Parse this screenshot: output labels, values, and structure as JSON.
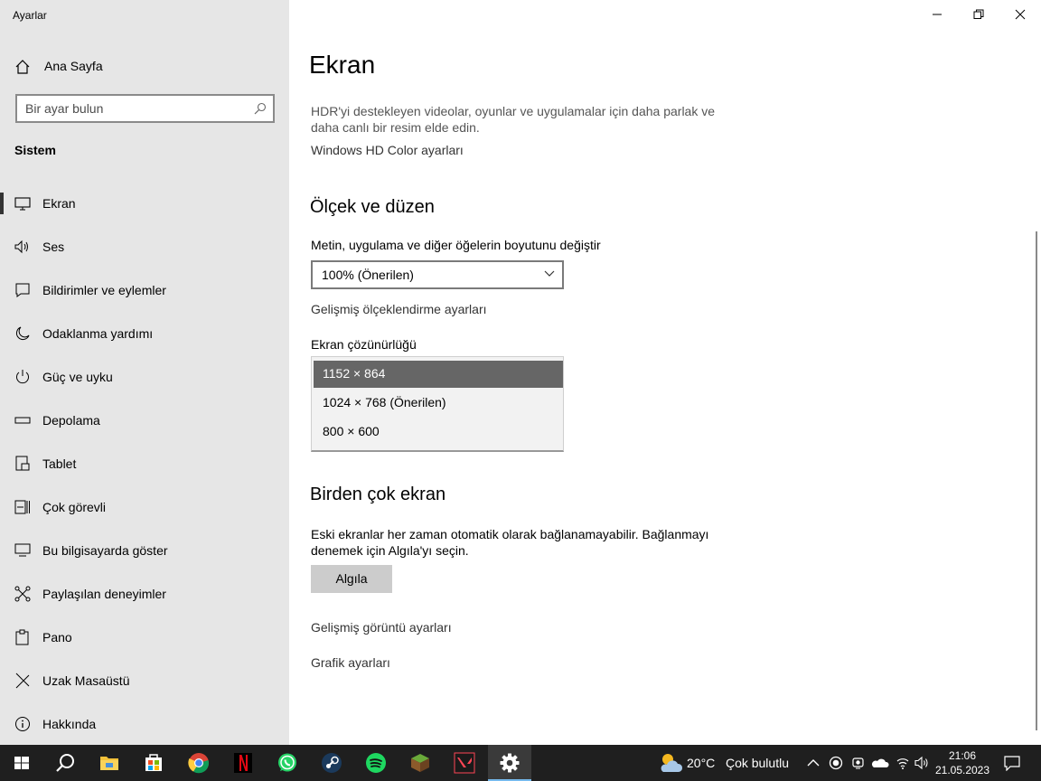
{
  "window": {
    "app_title": "Ayarlar"
  },
  "sidebar": {
    "home_label": "Ana Sayfa",
    "search_placeholder": "Bir ayar bulun",
    "section_title": "Sistem",
    "items": [
      {
        "label": "Ekran",
        "icon": "monitor-icon",
        "active": true
      },
      {
        "label": "Ses",
        "icon": "speaker-icon"
      },
      {
        "label": "Bildirimler ve eylemler",
        "icon": "notifications-icon"
      },
      {
        "label": "Odaklanma yardımı",
        "icon": "moon-icon"
      },
      {
        "label": "Güç ve uyku",
        "icon": "power-icon"
      },
      {
        "label": "Depolama",
        "icon": "storage-icon"
      },
      {
        "label": "Tablet",
        "icon": "tablet-icon"
      },
      {
        "label": "Çok görevli",
        "icon": "multitasking-icon"
      },
      {
        "label": "Bu bilgisayarda göster",
        "icon": "projecting-icon"
      },
      {
        "label": "Paylaşılan deneyimler",
        "icon": "shared-experiences-icon"
      },
      {
        "label": "Pano",
        "icon": "clipboard-icon"
      },
      {
        "label": "Uzak Masaüstü",
        "icon": "remote-desktop-icon"
      },
      {
        "label": "Hakkında",
        "icon": "info-icon"
      }
    ]
  },
  "main": {
    "title": "Ekran",
    "hdr_description": "HDR'yi destekleyen videolar, oyunlar ve uygulamalar için daha parlak ve daha canlı bir resim elde edin.",
    "hdr_link": "Windows HD Color ayarları",
    "scale_section": "Ölçek ve düzen",
    "scale_label": "Metin, uygulama ve diğer öğelerin boyutunu değiştir",
    "scale_value": "100% (Önerilen)",
    "advanced_scaling_link": "Gelişmiş ölçeklendirme ayarları",
    "resolution_label": "Ekran çözünürlüğü",
    "resolution_options": [
      "1152 × 864",
      "1024 × 768 (Önerilen)",
      "800 × 600"
    ],
    "resolution_selected": "1152 × 864",
    "multi_section": "Birden çok ekran",
    "multi_description": "Eski ekranlar her zaman otomatik olarak bağlanamayabilir. Bağlanmayı denemek için Algıla'yı seçin.",
    "detect_button": "Algıla",
    "advanced_display_link": "Gelişmiş görüntü ayarları",
    "graphics_link": "Grafik ayarları"
  },
  "taskbar": {
    "apps": [
      "start-icon",
      "search-icon",
      "file-explorer-icon",
      "store-icon",
      "chrome-icon",
      "netflix-icon",
      "whatsapp-icon",
      "steam-icon",
      "spotify-icon",
      "minecraft-icon",
      "valorant-icon",
      "settings-icon"
    ],
    "weather_temp": "20°C",
    "weather_text": "Çok bulutlu",
    "time": "21:06",
    "date": "21.05.2023",
    "accent": "#76b9ed"
  }
}
